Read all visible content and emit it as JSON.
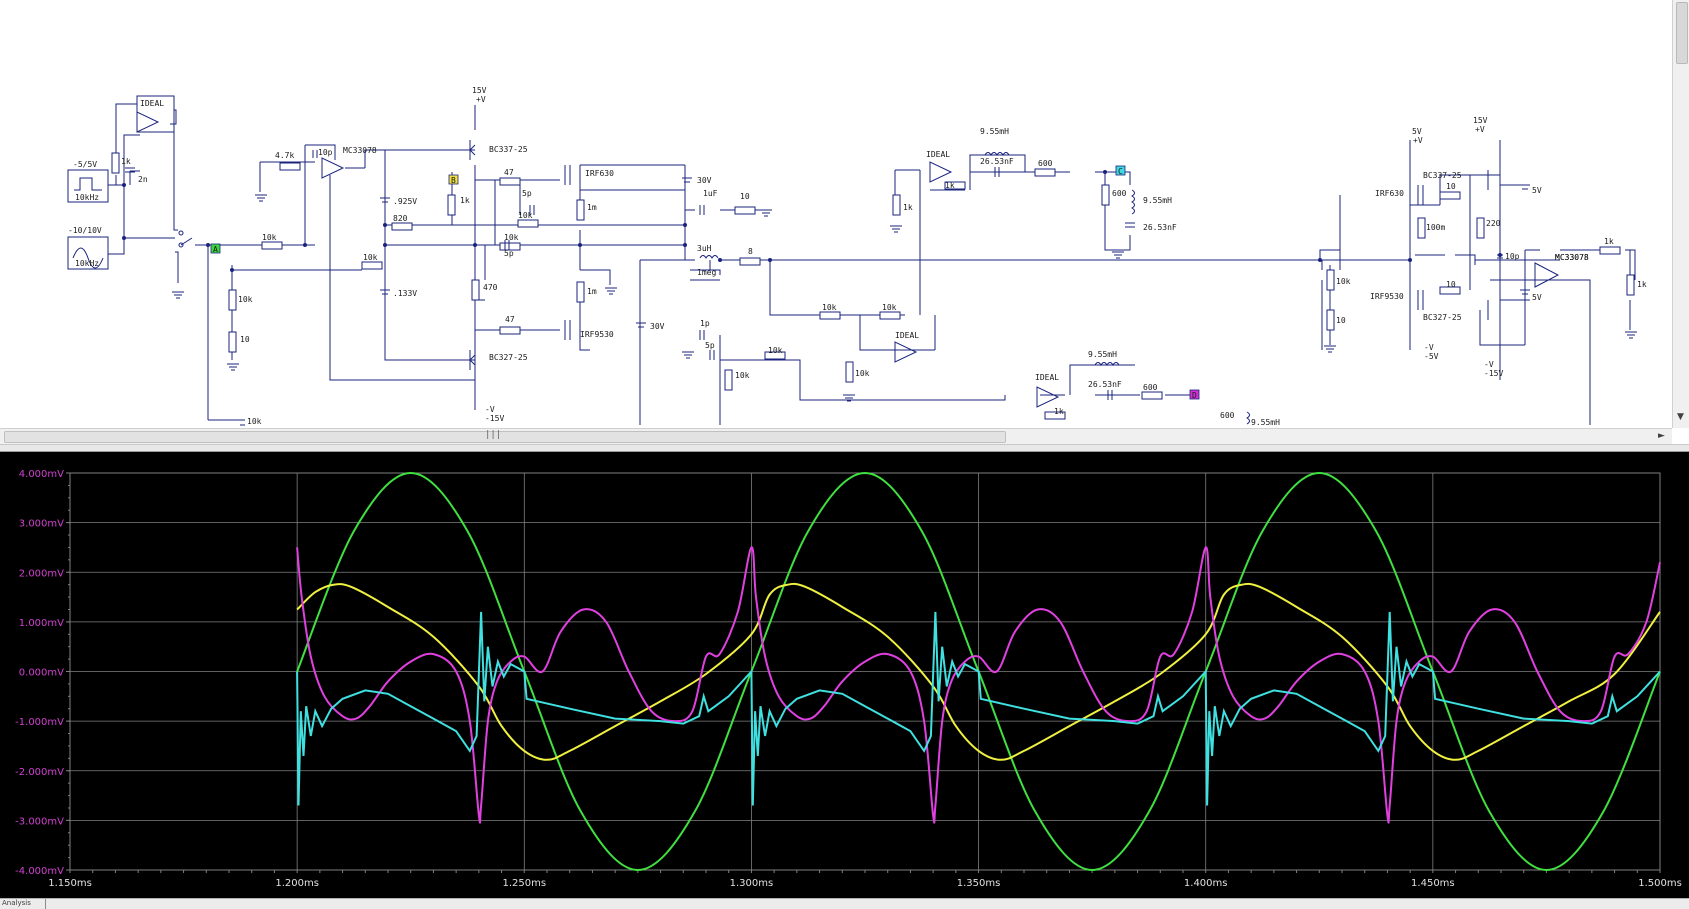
{
  "schematic": {
    "parts": [
      {
        "name": "opamp-ideal-1",
        "label": "IDEAL"
      },
      {
        "name": "opamp-mc33078-1",
        "label": "MC33078"
      },
      {
        "name": "opamp-ideal-2",
        "label": "IDEAL"
      },
      {
        "name": "opamp-ideal-3",
        "label": "IDEAL"
      },
      {
        "name": "opamp-ideal-4",
        "label": "IDEAL"
      },
      {
        "name": "opamp-mc33078-2",
        "label": "MC33078"
      }
    ],
    "labels": [
      {
        "name": "src-square-label",
        "text": "-5/5V"
      },
      {
        "name": "src-square-freq",
        "text": "10kHz"
      },
      {
        "name": "src-sine-label",
        "text": "-10/10V"
      },
      {
        "name": "src-sine-freq",
        "text": "10kHz"
      },
      {
        "name": "r-1k-a",
        "text": "1k"
      },
      {
        "name": "c-2n",
        "text": "2n"
      },
      {
        "name": "r-4-7k",
        "text": "4.7k"
      },
      {
        "name": "c-10p-a",
        "text": "10p"
      },
      {
        "name": "v-925",
        "text": ".925V"
      },
      {
        "name": "r-820",
        "text": "820"
      },
      {
        "name": "r-10k-a",
        "text": "10k"
      },
      {
        "name": "r-10k-b",
        "text": "10k"
      },
      {
        "name": "v-133",
        "text": ".133V"
      },
      {
        "name": "r-10k-c",
        "text": "10k"
      },
      {
        "name": "r-10-a",
        "text": "10"
      },
      {
        "name": "r-10k-d",
        "text": "10k"
      },
      {
        "name": "v-15-top",
        "text": "15V"
      },
      {
        "name": "v-plus-top",
        "text": "+V"
      },
      {
        "name": "q-bc337-a",
        "text": "BC337-25"
      },
      {
        "name": "r-1k-b",
        "text": "1k"
      },
      {
        "name": "r-470",
        "text": "470"
      },
      {
        "name": "q-bc327-a",
        "text": "BC327-25"
      },
      {
        "name": "v-minus-a",
        "text": "-V"
      },
      {
        "name": "v-15-bot",
        "text": "-15V"
      },
      {
        "name": "r-47-a",
        "text": "47"
      },
      {
        "name": "c-5p-a",
        "text": "5p"
      },
      {
        "name": "r-10k-e",
        "text": "10k"
      },
      {
        "name": "r-10k-f",
        "text": "10k"
      },
      {
        "name": "c-5p-b",
        "text": "5p"
      },
      {
        "name": "r-47-b",
        "text": "47"
      },
      {
        "name": "m-irf630-a",
        "text": "IRF630"
      },
      {
        "name": "m-irf9530-a",
        "text": "IRF9530"
      },
      {
        "name": "r-1m-a",
        "text": "1m"
      },
      {
        "name": "r-1m-b",
        "text": "1m"
      },
      {
        "name": "v-30-a",
        "text": "30V"
      },
      {
        "name": "v-30-b",
        "text": "30V"
      },
      {
        "name": "c-1uf",
        "text": "1uF"
      },
      {
        "name": "r-10-b",
        "text": "10"
      },
      {
        "name": "l-3uh",
        "text": "3uH"
      },
      {
        "name": "r-1meg",
        "text": "1meg"
      },
      {
        "name": "r-8",
        "text": "8"
      },
      {
        "name": "c-1p",
        "text": "1p"
      },
      {
        "name": "c-5p-c",
        "text": "5p"
      },
      {
        "name": "r-10k-g",
        "text": "10k"
      },
      {
        "name": "r-10k-h",
        "text": "10k"
      },
      {
        "name": "r-10k-i",
        "text": "10k"
      },
      {
        "name": "r-10k-j",
        "text": "10k"
      },
      {
        "name": "r-10k-k",
        "text": "10k"
      },
      {
        "name": "r-1k-c",
        "text": "1k"
      },
      {
        "name": "l-955-a",
        "text": "9.55mH"
      },
      {
        "name": "c-2653-a",
        "text": "26.53nF"
      },
      {
        "name": "r-600-a",
        "text": "600"
      },
      {
        "name": "r-600-b",
        "text": "600"
      },
      {
        "name": "l-955-b",
        "text": "9.55mH"
      },
      {
        "name": "c-2653-b",
        "text": "26.53nF"
      },
      {
        "name": "r-1k-d",
        "text": "1k"
      },
      {
        "name": "r-1k-e",
        "text": "1k"
      },
      {
        "name": "l-955-c",
        "text": "9.55mH"
      },
      {
        "name": "c-2653-c",
        "text": "26.53nF"
      },
      {
        "name": "r-600-c",
        "text": "600"
      },
      {
        "name": "r-600-d",
        "text": "600"
      },
      {
        "name": "l-955-d",
        "text": "9.55mH"
      },
      {
        "name": "r-10k-l",
        "text": "10k"
      },
      {
        "name": "r-10-c",
        "text": "10"
      },
      {
        "name": "v-5-top",
        "text": "5V"
      },
      {
        "name": "v-plus-2",
        "text": "+V"
      },
      {
        "name": "v-15-top-2",
        "text": "15V"
      },
      {
        "name": "v-plus-3",
        "text": "+V"
      },
      {
        "name": "m-irf630-b",
        "text": "IRF630"
      },
      {
        "name": "q-bc337-b",
        "text": "BC337-25"
      },
      {
        "name": "r-10-d",
        "text": "10"
      },
      {
        "name": "r-100m",
        "text": "100m"
      },
      {
        "name": "r-220",
        "text": "220"
      },
      {
        "name": "c-10p-b",
        "text": "10p"
      },
      {
        "name": "opamp-mc33078-2-label",
        "text": "MC33078"
      },
      {
        "name": "r-1k-f",
        "text": "1k"
      },
      {
        "name": "r-1k-g",
        "text": "1k"
      },
      {
        "name": "v-5v-a",
        "text": "5V"
      },
      {
        "name": "v-5v-b",
        "text": "5V"
      },
      {
        "name": "m-irf9530-b",
        "text": "IRF9530"
      },
      {
        "name": "r-10-e",
        "text": "10"
      },
      {
        "name": "q-bc327-b",
        "text": "BC327-25"
      },
      {
        "name": "v-minus-b",
        "text": "-V"
      },
      {
        "name": "v-minus-5",
        "text": "-5V"
      },
      {
        "name": "v-minus-c",
        "text": "-V"
      },
      {
        "name": "v-minus-15",
        "text": "-15V"
      }
    ],
    "nodes": [
      {
        "name": "node-tag-a",
        "text": "A",
        "color": "#3cd63c"
      },
      {
        "name": "node-tag-b",
        "text": "B",
        "color": "#f0e040"
      },
      {
        "name": "node-tag-c",
        "text": "C",
        "color": "#40d8e0"
      },
      {
        "name": "node-tag-d",
        "text": "D",
        "color": "#d030d0"
      }
    ],
    "hscroll_grip": "|||"
  },
  "plot": {
    "background": "#000000",
    "grid_color": "#808080",
    "y_tick_color": "#d040d0",
    "x_tick_color": "#e0e0e0"
  },
  "chart_data": {
    "type": "line",
    "title": "",
    "xlabel": "",
    "ylabel": "",
    "xlim_ms": [
      1.15,
      1.5
    ],
    "ylim_mV": [
      -4.0,
      4.0
    ],
    "grid": true,
    "x_tick_labels": [
      "1.150ms",
      "1.200ms",
      "1.250ms",
      "1.300ms",
      "1.350ms",
      "1.400ms",
      "1.450ms",
      "1.500ms"
    ],
    "x_ticks_ms": [
      1.15,
      1.2,
      1.25,
      1.3,
      1.35,
      1.4,
      1.45,
      1.5
    ],
    "y_tick_labels": [
      "4.000mV",
      "3.000mV",
      "2.000mV",
      "1.000mV",
      "0.000mV",
      "-1.000mV",
      "-2.000mV",
      "-3.000mV",
      "-4.000mV"
    ],
    "y_ticks_mV": [
      4,
      3,
      2,
      1,
      0,
      -1,
      -2,
      -3,
      -4
    ],
    "series": [
      {
        "color": "#40e040",
        "x": [
          1.2,
          1.2125,
          1.225,
          1.2375,
          1.25,
          1.2625,
          1.275,
          1.2875,
          1.3,
          1.3125,
          1.325,
          1.3375,
          1.35,
          1.3625,
          1.375,
          1.3875,
          1.4,
          1.4125,
          1.425,
          1.4375,
          1.45,
          1.4625,
          1.475,
          1.4875,
          1.5
        ],
        "y": [
          0.0,
          2.83,
          4.0,
          2.83,
          0.0,
          -2.83,
          -4.0,
          -2.83,
          0.0,
          2.83,
          4.0,
          2.83,
          0.0,
          -2.83,
          -4.0,
          -2.83,
          0.0,
          2.83,
          4.0,
          2.83,
          0.0,
          -2.83,
          -4.0,
          -2.83,
          0.0
        ]
      },
      {
        "color": "#f0f040",
        "x": [
          1.2,
          1.204,
          1.208,
          1.212,
          1.22,
          1.23,
          1.24,
          1.245,
          1.25,
          1.255,
          1.26,
          1.27,
          1.28,
          1.29,
          1.3,
          1.304,
          1.308,
          1.312,
          1.32,
          1.33,
          1.34,
          1.345,
          1.35,
          1.355,
          1.36,
          1.37,
          1.38,
          1.39,
          1.4,
          1.404,
          1.408,
          1.412,
          1.42,
          1.43,
          1.44,
          1.445,
          1.45,
          1.455,
          1.46,
          1.47,
          1.48,
          1.49,
          1.5
        ],
        "y": [
          1.25,
          1.6,
          1.75,
          1.7,
          1.3,
          0.7,
          -0.3,
          -1.1,
          -1.6,
          -1.78,
          -1.6,
          -1.1,
          -0.6,
          -0.05,
          0.75,
          1.55,
          1.75,
          1.7,
          1.3,
          0.7,
          -0.3,
          -1.1,
          -1.6,
          -1.78,
          -1.6,
          -1.1,
          -0.6,
          -0.05,
          0.75,
          1.55,
          1.75,
          1.7,
          1.3,
          0.7,
          -0.3,
          -1.1,
          -1.6,
          -1.78,
          -1.6,
          -1.1,
          -0.6,
          -0.05,
          1.2
        ]
      },
      {
        "color": "#e040e0",
        "x": [
          1.2,
          1.201,
          1.203,
          1.206,
          1.21,
          1.213,
          1.216,
          1.22,
          1.225,
          1.23,
          1.235,
          1.238,
          1.24,
          1.2405,
          1.242,
          1.244,
          1.247,
          1.25,
          1.254,
          1.258,
          1.263,
          1.268,
          1.273,
          1.278,
          1.283,
          1.287,
          1.29,
          1.293,
          1.297,
          1.3,
          1.301,
          1.303,
          1.306,
          1.31,
          1.313,
          1.316,
          1.32,
          1.325,
          1.33,
          1.335,
          1.338,
          1.34,
          1.3405,
          1.342,
          1.344,
          1.347,
          1.35,
          1.354,
          1.358,
          1.363,
          1.368,
          1.373,
          1.378,
          1.383,
          1.387,
          1.39,
          1.393,
          1.397,
          1.4,
          1.401,
          1.403,
          1.406,
          1.41,
          1.413,
          1.416,
          1.42,
          1.425,
          1.43,
          1.435,
          1.438,
          1.44,
          1.4405,
          1.442,
          1.444,
          1.447,
          1.45,
          1.454,
          1.458,
          1.463,
          1.468,
          1.473,
          1.478,
          1.483,
          1.487,
          1.49,
          1.493,
          1.497,
          1.5
        ],
        "y": [
          2.5,
          1.5,
          0.3,
          -0.5,
          -0.9,
          -0.95,
          -0.7,
          -0.2,
          0.2,
          0.35,
          0.0,
          -1.0,
          -2.9,
          -2.7,
          -1.0,
          -0.2,
          0.2,
          0.3,
          0.0,
          0.8,
          1.25,
          1.0,
          0.0,
          -0.8,
          -1.0,
          -0.8,
          0.3,
          0.35,
          1.2,
          2.5,
          1.5,
          0.3,
          -0.5,
          -0.9,
          -0.95,
          -0.7,
          -0.2,
          0.2,
          0.35,
          0.0,
          -1.0,
          -2.9,
          -2.7,
          -1.0,
          -0.2,
          0.2,
          0.3,
          0.0,
          0.8,
          1.25,
          1.0,
          0.0,
          -0.8,
          -1.0,
          -0.8,
          0.3,
          0.35,
          1.2,
          2.5,
          1.5,
          0.3,
          -0.5,
          -0.9,
          -0.95,
          -0.7,
          -0.2,
          0.2,
          0.35,
          0.0,
          -1.0,
          -2.9,
          -2.7,
          -1.0,
          -0.2,
          0.2,
          0.3,
          0.0,
          0.8,
          1.25,
          1.0,
          0.0,
          -0.8,
          -1.0,
          -0.8,
          0.3,
          0.35,
          1.0,
          2.2
        ]
      },
      {
        "color": "#40e0e0",
        "x": [
          1.2,
          1.2003,
          1.2008,
          1.2014,
          1.202,
          1.203,
          1.204,
          1.2055,
          1.2075,
          1.21,
          1.215,
          1.22,
          1.225,
          1.23,
          1.235,
          1.238,
          1.2395,
          1.2405,
          1.2412,
          1.242,
          1.243,
          1.2442,
          1.2455,
          1.247,
          1.25,
          1.2505,
          1.26,
          1.27,
          1.28,
          1.285,
          1.2885,
          1.2895,
          1.2905,
          1.295,
          1.3,
          1.3003,
          1.3008,
          1.3014,
          1.302,
          1.303,
          1.304,
          1.3055,
          1.3075,
          1.31,
          1.315,
          1.32,
          1.325,
          1.33,
          1.335,
          1.338,
          1.3395,
          1.3405,
          1.3412,
          1.342,
          1.343,
          1.3442,
          1.3455,
          1.347,
          1.35,
          1.3505,
          1.36,
          1.37,
          1.38,
          1.385,
          1.3885,
          1.3895,
          1.3905,
          1.395,
          1.4,
          1.4003,
          1.4008,
          1.4014,
          1.402,
          1.403,
          1.404,
          1.4055,
          1.4075,
          1.41,
          1.415,
          1.42,
          1.425,
          1.43,
          1.435,
          1.438,
          1.4395,
          1.4405,
          1.4412,
          1.442,
          1.443,
          1.4442,
          1.4455,
          1.447,
          1.45,
          1.4505,
          1.46,
          1.47,
          1.48,
          1.485,
          1.4885,
          1.4895,
          1.4905,
          1.495,
          1.5
        ],
        "y": [
          0.0,
          -2.7,
          -0.8,
          -1.7,
          -0.7,
          -1.3,
          -0.8,
          -1.1,
          -0.75,
          -0.55,
          -0.38,
          -0.45,
          -0.7,
          -0.95,
          -1.2,
          -1.6,
          -1.3,
          1.2,
          -0.6,
          0.5,
          -0.3,
          0.2,
          -0.1,
          0.15,
          0.0,
          -0.55,
          -0.75,
          -0.95,
          -1.0,
          -1.05,
          -0.9,
          -0.5,
          -0.8,
          -0.5,
          0.0,
          -2.7,
          -0.8,
          -1.7,
          -0.7,
          -1.3,
          -0.8,
          -1.1,
          -0.75,
          -0.55,
          -0.38,
          -0.45,
          -0.7,
          -0.95,
          -1.2,
          -1.6,
          -1.3,
          1.2,
          -0.6,
          0.5,
          -0.3,
          0.2,
          -0.1,
          0.15,
          0.0,
          -0.55,
          -0.75,
          -0.95,
          -1.0,
          -1.05,
          -0.9,
          -0.5,
          -0.8,
          -0.5,
          0.0,
          -2.7,
          -0.8,
          -1.7,
          -0.7,
          -1.3,
          -0.8,
          -1.1,
          -0.75,
          -0.55,
          -0.38,
          -0.45,
          -0.7,
          -0.95,
          -1.2,
          -1.6,
          -1.3,
          1.2,
          -0.6,
          0.5,
          -0.3,
          0.2,
          -0.1,
          0.15,
          0.0,
          -0.55,
          -0.75,
          -0.95,
          -1.0,
          -1.05,
          -0.9,
          -0.5,
          -0.8,
          -0.5,
          0.0
        ]
      }
    ]
  },
  "status": {
    "tab_label": "Analysis"
  }
}
